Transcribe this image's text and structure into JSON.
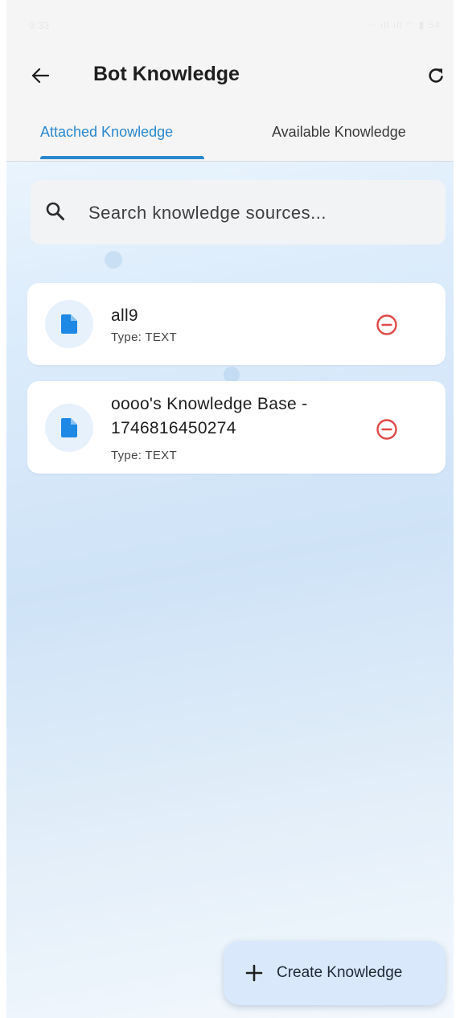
{
  "status_bar": {
    "time": "9:33",
    "indicators": "⋯ ıll ıll ◠ ▮ 54"
  },
  "app_bar": {
    "title": "Bot Knowledge",
    "back_icon": "arrow-left-icon",
    "refresh_icon": "refresh-icon"
  },
  "tabs": [
    {
      "label": "Attached Knowledge",
      "active": true
    },
    {
      "label": "Available Knowledge",
      "active": false
    }
  ],
  "search": {
    "placeholder": "Search knowledge sources...",
    "value": "",
    "icon": "search-icon"
  },
  "knowledge_items": [
    {
      "name": "all9",
      "type": "Type: TEXT",
      "icon": "document-icon",
      "action_icon": "remove-circle-icon"
    },
    {
      "name": "oooo's Knowledge Base - 1746816450274",
      "type": "Type: TEXT",
      "icon": "document-icon",
      "action_icon": "remove-circle-icon"
    }
  ],
  "fab": {
    "label": "Create Knowledge",
    "icon": "plus-icon"
  },
  "colors": {
    "accent": "#2a88cf",
    "remove": "#e04848",
    "doc_icon": "#1e88e5",
    "fab_bg": "#d9e8fa"
  }
}
